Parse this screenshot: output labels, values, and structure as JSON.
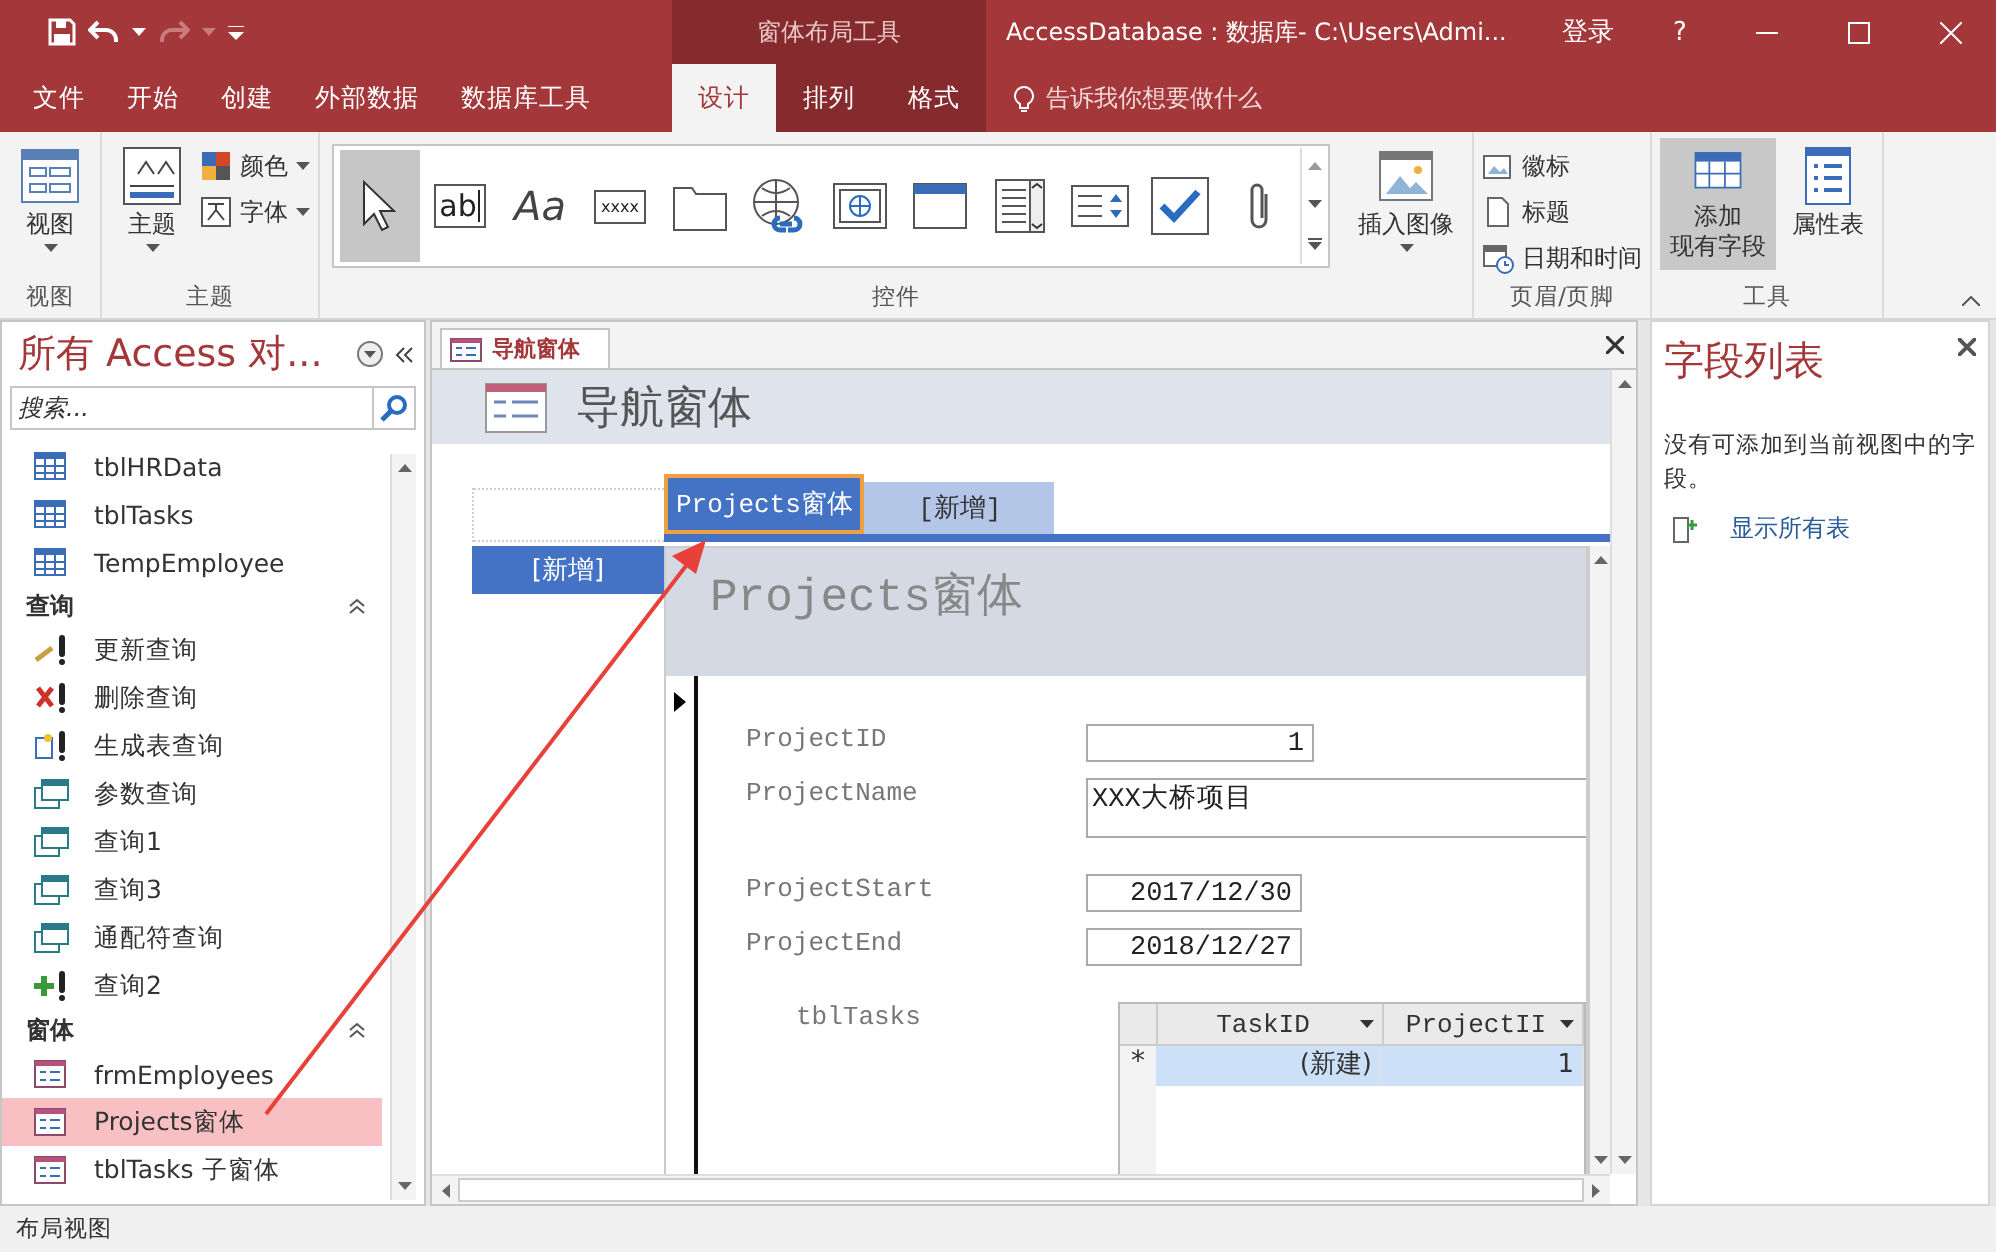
{
  "title_bar": {
    "context_tab": "窗体布局工具",
    "title": "AccessDatabase : 数据库- C:\\Users\\Admi...",
    "sign_in": "登录",
    "help": "?"
  },
  "ribbon_tabs": [
    {
      "label": "文件",
      "selected": false
    },
    {
      "label": "开始",
      "selected": false
    },
    {
      "label": "创建",
      "selected": false
    },
    {
      "label": "外部数据",
      "selected": false
    },
    {
      "label": "数据库工具",
      "selected": false
    }
  ],
  "contextual_tabs": [
    {
      "label": "设计",
      "selected": true
    },
    {
      "label": "排列",
      "selected": false
    },
    {
      "label": "格式",
      "selected": false
    }
  ],
  "tell_me": "告诉我你想要做什么",
  "ribbon_groups": [
    {
      "label": "视图",
      "large": [
        {
          "kind": "view",
          "label_lines": [
            "视图"
          ],
          "dropdown": true,
          "selected": false
        }
      ]
    },
    {
      "label": "主题",
      "large": [
        {
          "kind": "theme",
          "label_lines": [
            "主题"
          ],
          "dropdown": true,
          "selected": false
        }
      ],
      "small": [
        {
          "kind": "colors",
          "label": "颜色",
          "dropdown": true
        },
        {
          "kind": "fonts",
          "label": "字体",
          "dropdown": true
        }
      ]
    },
    {
      "label": "控件",
      "gallery": [
        {
          "kind": "pointer",
          "selected": true
        },
        {
          "kind": "textbox",
          "glyph": "ab",
          "selected": false
        },
        {
          "kind": "label",
          "glyph": "Aa",
          "selected": false
        },
        {
          "kind": "command",
          "glyph": "xxxx",
          "selected": false
        },
        {
          "kind": "tab",
          "selected": false
        },
        {
          "kind": "hyperlink",
          "selected": false
        },
        {
          "kind": "web",
          "selected": false
        },
        {
          "kind": "navigation",
          "selected": false
        },
        {
          "kind": "combo",
          "selected": false
        },
        {
          "kind": "list",
          "selected": false
        },
        {
          "kind": "checkbox",
          "selected": false
        },
        {
          "kind": "attachment",
          "selected": false
        }
      ],
      "large": [
        {
          "kind": "image",
          "label_lines": [
            "插入图像"
          ],
          "dropdown": true,
          "selected": false
        }
      ]
    },
    {
      "label": "页眉/页脚",
      "small": [
        {
          "kind": "logo",
          "label": "徽标",
          "dropdown": false
        },
        {
          "kind": "title",
          "label": "标题",
          "dropdown": false
        },
        {
          "kind": "datetime",
          "label": "日期和时间",
          "dropdown": false
        }
      ]
    },
    {
      "label": "工具",
      "large": [
        {
          "kind": "add_fields",
          "label_lines": [
            "添加",
            "现有字段"
          ],
          "dropdown": false,
          "selected": true
        },
        {
          "kind": "property_sheet",
          "label_lines": [
            "属性表"
          ],
          "dropdown": false,
          "selected": false
        }
      ]
    }
  ],
  "nav_pane": {
    "title": "所有 Access 对...",
    "search_placeholder": "搜索...",
    "items": [
      {
        "kind": "table",
        "label": "tblHRData",
        "selected": false
      },
      {
        "kind": "table",
        "label": "tblTasks",
        "selected": false
      },
      {
        "kind": "table",
        "label": "TempEmployee",
        "selected": false
      },
      {
        "kind": "header",
        "label": "查询"
      },
      {
        "kind": "update_query",
        "label": "更新查询",
        "selected": false
      },
      {
        "kind": "delete_query",
        "label": "删除查询",
        "selected": false
      },
      {
        "kind": "make_table_query",
        "label": "生成表查询",
        "selected": false
      },
      {
        "kind": "select_query",
        "label": "参数查询",
        "selected": false
      },
      {
        "kind": "select_query",
        "label": "查询1",
        "selected": false
      },
      {
        "kind": "select_query",
        "label": "查询3",
        "selected": false
      },
      {
        "kind": "select_query",
        "label": "通配符查询",
        "selected": false
      },
      {
        "kind": "append_query",
        "label": "查询2",
        "selected": false
      },
      {
        "kind": "header",
        "label": "窗体"
      },
      {
        "kind": "form",
        "label": "frmEmployees",
        "selected": false
      },
      {
        "kind": "form",
        "label": "Projects窗体",
        "selected": true
      },
      {
        "kind": "form",
        "label": "tblTasks 子窗体",
        "selected": false
      }
    ]
  },
  "document": {
    "tab": {
      "label": "导航窗体",
      "selected": true
    },
    "header_title": "导航窗体",
    "top_tabs": [
      {
        "label": "Projects窗体",
        "selected": true
      },
      {
        "label": "[新增]",
        "selected": false
      }
    ],
    "side_tabs": [
      {
        "label": "[新增]",
        "selected": false
      }
    ],
    "subform": {
      "title": "Projects窗体",
      "fields": [
        {
          "label": "ProjectID",
          "value": "1",
          "kind": "number"
        },
        {
          "label": "ProjectName",
          "value": "XXX大桥项目",
          "kind": "memo"
        },
        {
          "label": "ProjectStart",
          "value": "2017/12/30",
          "kind": "date"
        },
        {
          "label": "ProjectEnd",
          "value": "2018/12/27",
          "kind": "date"
        }
      ],
      "datasheet": {
        "label": "tblTasks",
        "columns": [
          "TaskID",
          "ProjectII"
        ],
        "rows": [
          {
            "marker": "*",
            "cells": [
              "(新建)",
              "1"
            ],
            "selected": true
          }
        ]
      }
    }
  },
  "field_list": {
    "title": "字段列表",
    "message": "没有可添加到当前视图中的字段。",
    "link": "显示所有表"
  },
  "status_bar": {
    "text": "布局视图"
  }
}
